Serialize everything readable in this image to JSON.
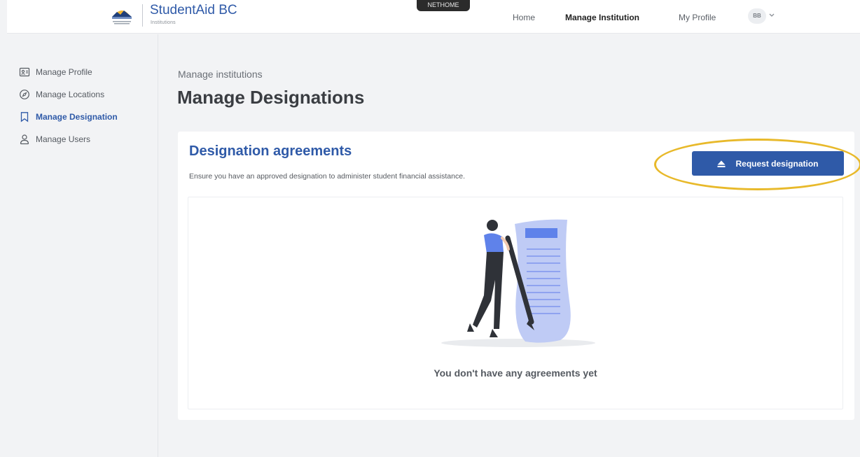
{
  "header": {
    "brand": "StudentAid BC",
    "brand_sub": "Institutions",
    "env_badge": "NETHOME",
    "nav": {
      "home": "Home",
      "manage_institution": "Manage Institution",
      "my_profile": "My Profile"
    },
    "avatar_initials": "BB"
  },
  "sidebar": {
    "items": [
      {
        "label": "Manage Profile",
        "icon": "profile-card-icon",
        "active": false
      },
      {
        "label": "Manage Locations",
        "icon": "compass-icon",
        "active": false
      },
      {
        "label": "Manage Designation",
        "icon": "bookmark-icon",
        "active": true
      },
      {
        "label": "Manage Users",
        "icon": "user-icon",
        "active": false
      }
    ]
  },
  "main": {
    "breadcrumb": "Manage institutions",
    "title": "Manage Designations",
    "card": {
      "title": "Designation agreements",
      "description": "Ensure you have an approved designation to administer student financial assistance.",
      "request_button": "Request designation",
      "empty_message": "You don't have any agreements yet"
    }
  },
  "colors": {
    "accent": "#2f5aa8",
    "highlight": "#e8b92a"
  }
}
